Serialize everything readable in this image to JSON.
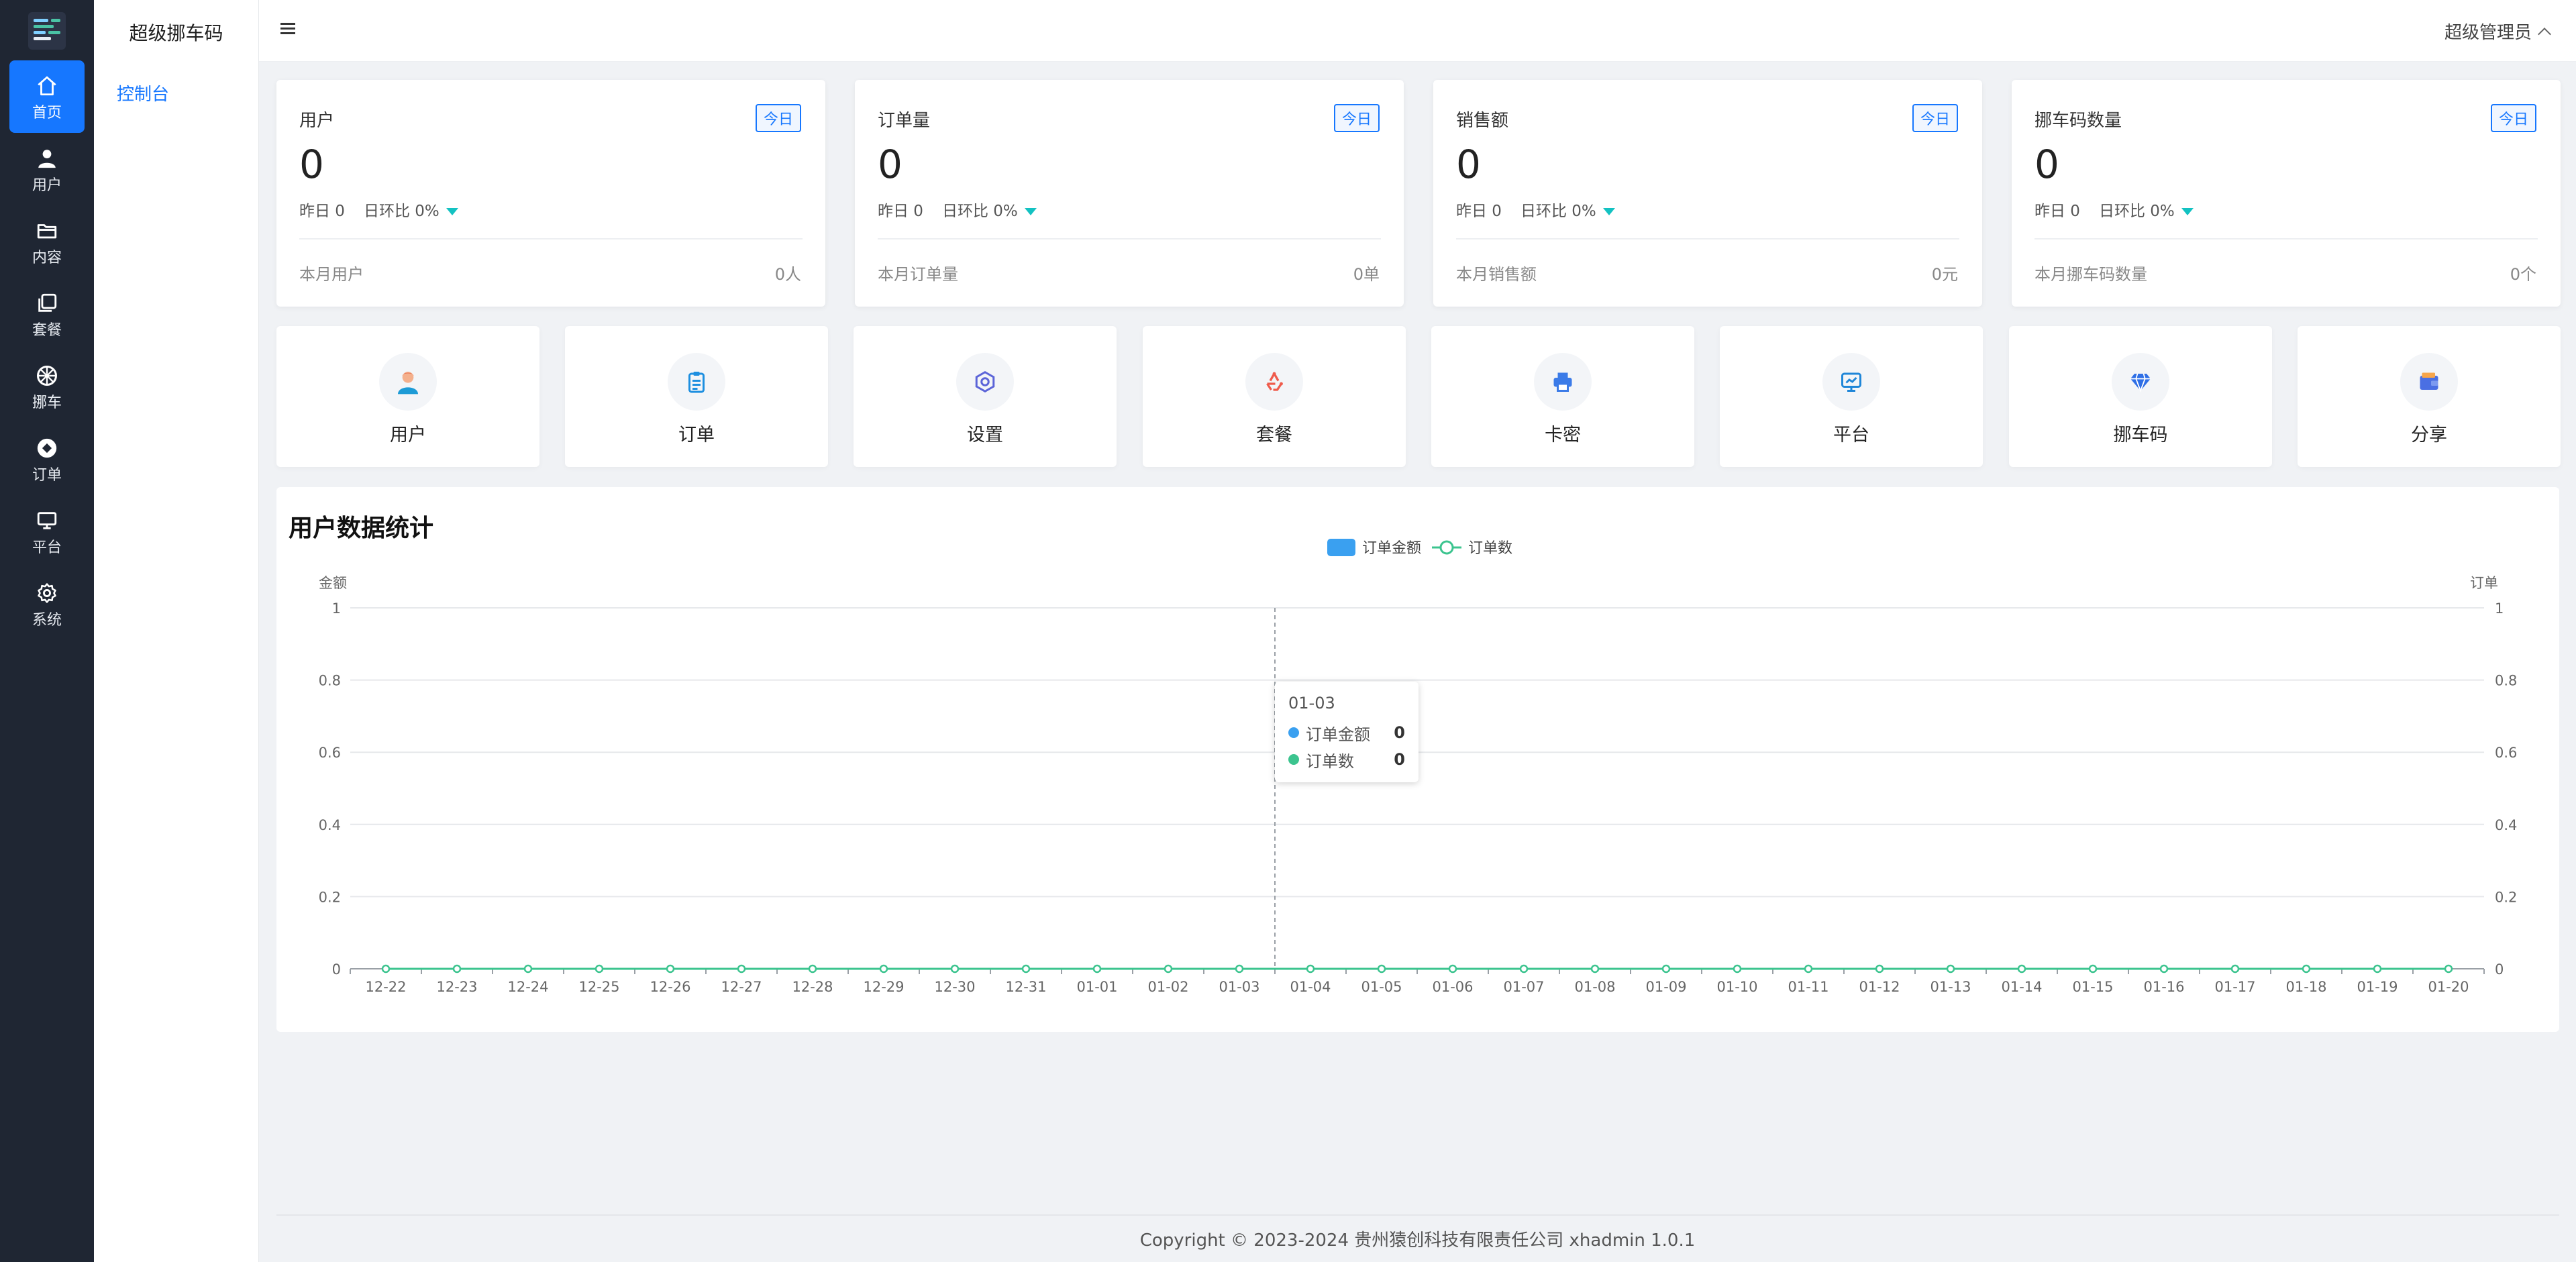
{
  "app": {
    "title": "超级挪车码"
  },
  "rail": [
    {
      "label": "首页",
      "icon": "home-icon",
      "active": true
    },
    {
      "label": "用户",
      "icon": "user-icon"
    },
    {
      "label": "内容",
      "icon": "folder-icon"
    },
    {
      "label": "套餐",
      "icon": "copy-icon"
    },
    {
      "label": "挪车",
      "icon": "wheel-icon"
    },
    {
      "label": "订单",
      "icon": "order-icon"
    },
    {
      "label": "平台",
      "icon": "monitor-icon"
    },
    {
      "label": "系统",
      "icon": "gear-icon"
    }
  ],
  "subnav": {
    "item": "控制台"
  },
  "header": {
    "user": "超级管理员"
  },
  "stats": [
    {
      "name": "用户",
      "tag": "今日",
      "value": "0",
      "yesterday": "昨日 0",
      "ratio": "日环比 0%",
      "month_label": "本月用户",
      "month_value": "0人"
    },
    {
      "name": "订单量",
      "tag": "今日",
      "value": "0",
      "yesterday": "昨日 0",
      "ratio": "日环比 0%",
      "month_label": "本月订单量",
      "month_value": "0单"
    },
    {
      "name": "销售额",
      "tag": "今日",
      "value": "0",
      "yesterday": "昨日 0",
      "ratio": "日环比 0%",
      "month_label": "本月销售额",
      "month_value": "0元"
    },
    {
      "name": "挪车码数量",
      "tag": "今日",
      "value": "0",
      "yesterday": "昨日 0",
      "ratio": "日环比 0%",
      "month_label": "本月挪车码数量",
      "month_value": "0个"
    }
  ],
  "quick_links": [
    {
      "label": "用户",
      "icon": "user-avatar-icon"
    },
    {
      "label": "订单",
      "icon": "clipboard-icon"
    },
    {
      "label": "设置",
      "icon": "hexagon-settings-icon"
    },
    {
      "label": "套餐",
      "icon": "recycle-icon"
    },
    {
      "label": "卡密",
      "icon": "printer-icon"
    },
    {
      "label": "平台",
      "icon": "screen-icon"
    },
    {
      "label": "挪车码",
      "icon": "diamond-icon"
    },
    {
      "label": "分享",
      "icon": "wallet-icon"
    }
  ],
  "chart_panel": {
    "title": "用户数据统计"
  },
  "tooltip": {
    "date": "01-03",
    "rows": [
      {
        "name": "订单金额",
        "value": "0"
      },
      {
        "name": "订单数",
        "value": "0"
      }
    ]
  },
  "chart_data": {
    "type": "bar",
    "x": [
      "12-22",
      "12-23",
      "12-24",
      "12-25",
      "12-26",
      "12-27",
      "12-28",
      "12-29",
      "12-30",
      "12-31",
      "01-01",
      "01-02",
      "01-03",
      "01-04",
      "01-05",
      "01-06",
      "01-07",
      "01-08",
      "01-09",
      "01-10",
      "01-11",
      "01-12",
      "01-13",
      "01-14",
      "01-15",
      "01-16",
      "01-17",
      "01-18",
      "01-19",
      "01-20"
    ],
    "series": [
      {
        "name": "订单金额",
        "type": "bar",
        "axis": "left",
        "color": "#3aa0f0",
        "values": [
          0,
          0,
          0,
          0,
          0,
          0,
          0,
          0,
          0,
          0,
          0,
          0,
          0,
          0,
          0,
          0,
          0,
          0,
          0,
          0,
          0,
          0,
          0,
          0,
          0,
          0,
          0,
          0,
          0,
          0
        ]
      },
      {
        "name": "订单数",
        "type": "line",
        "axis": "right",
        "color": "#3cc48f",
        "values": [
          0,
          0,
          0,
          0,
          0,
          0,
          0,
          0,
          0,
          0,
          0,
          0,
          0,
          0,
          0,
          0,
          0,
          0,
          0,
          0,
          0,
          0,
          0,
          0,
          0,
          0,
          0,
          0,
          0,
          0
        ]
      }
    ],
    "ylabel_left": "金额",
    "ylabel_right": "订单",
    "y_ticks": [
      "0",
      "0.2",
      "0.4",
      "0.6",
      "0.8",
      "1"
    ],
    "ylim": [
      0,
      1
    ],
    "legend_position": "top-center",
    "grid": true,
    "highlighted_x": "01-03"
  },
  "footer": {
    "copyright": "Copyright © 2023-2024 贵州猿创科技有限责任公司  xhadmin 1.0.1"
  },
  "colors": {
    "accent": "#1677ff",
    "rail_bg": "#1f2633",
    "trend_down": "#13c2c2"
  }
}
